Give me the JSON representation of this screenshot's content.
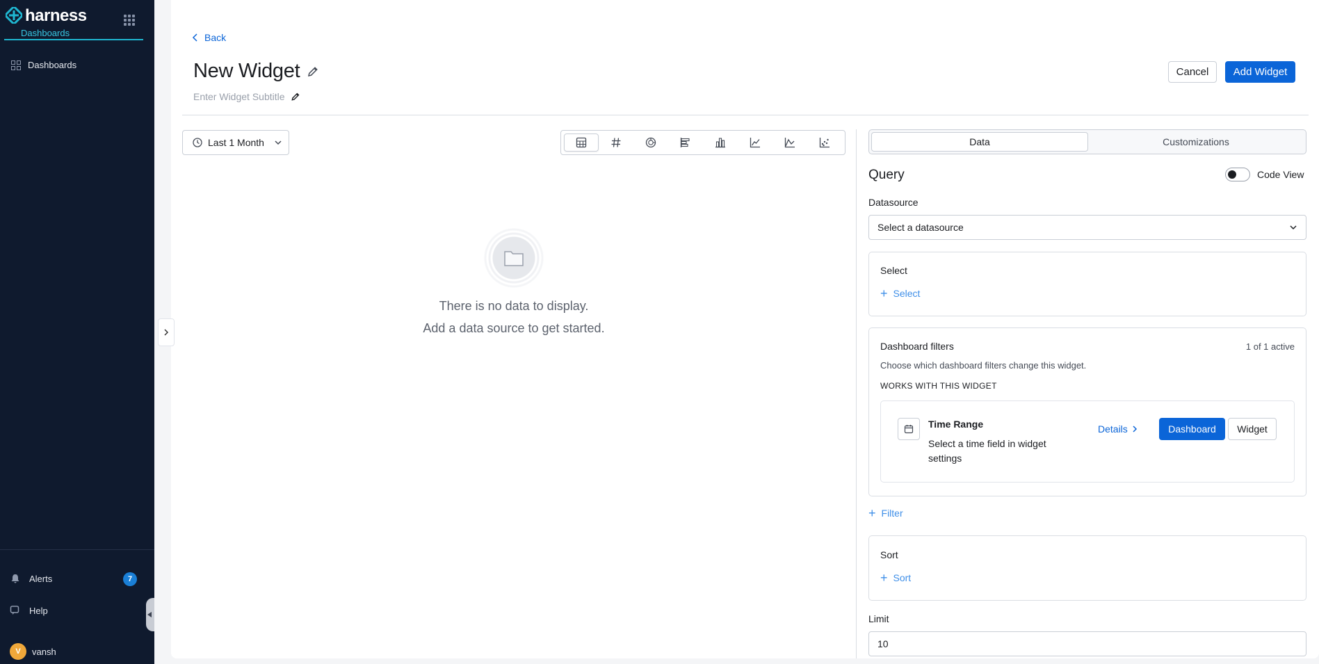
{
  "brand": {
    "name": "harness",
    "module": "Dashboards"
  },
  "sidebar": {
    "items": [
      {
        "label": "Dashboards"
      }
    ],
    "bottom": {
      "alerts_label": "Alerts",
      "alerts_count": "7",
      "help_label": "Help",
      "user_name": "vansh",
      "user_initial": "V"
    }
  },
  "header": {
    "back_label": "Back",
    "title": "New Widget",
    "subtitle_placeholder": "Enter Widget Subtitle",
    "cancel_label": "Cancel",
    "add_label": "Add Widget"
  },
  "preview": {
    "time_range_label": "Last 1 Month",
    "viz_types": [
      "table-icon",
      "number-icon",
      "pie-icon",
      "horizontal-bar-icon",
      "bar-icon",
      "line-icon",
      "area-icon",
      "scatter-icon"
    ],
    "empty_line_1": "There is no data to display.",
    "empty_line_2": "Add a data source to get started."
  },
  "panel": {
    "tabs": [
      {
        "label": "Data"
      },
      {
        "label": "Customizations"
      }
    ],
    "query_title": "Query",
    "code_view_label": "Code View",
    "datasource_label": "Datasource",
    "datasource_placeholder": "Select a datasource",
    "select_card": {
      "title": "Select",
      "add_label": "Select"
    },
    "filters_card": {
      "title": "Dashboard filters",
      "active_count": "1 of 1 active",
      "description": "Choose which dashboard filters change this widget.",
      "section_label": "WORKS WITH THIS WIDGET",
      "filter": {
        "name": "Time Range",
        "description": "Select a time field in widget settings",
        "details_label": "Details",
        "dashboard_label": "Dashboard",
        "widget_label": "Widget"
      }
    },
    "filter_add_label": "Filter",
    "sort_card": {
      "title": "Sort",
      "add_label": "Sort"
    },
    "limit_label": "Limit",
    "limit_value": "10"
  },
  "colors": {
    "sidebar_bg": "#0f1a2e",
    "primary": "#0b65d8",
    "accent": "#1fb7d1"
  }
}
